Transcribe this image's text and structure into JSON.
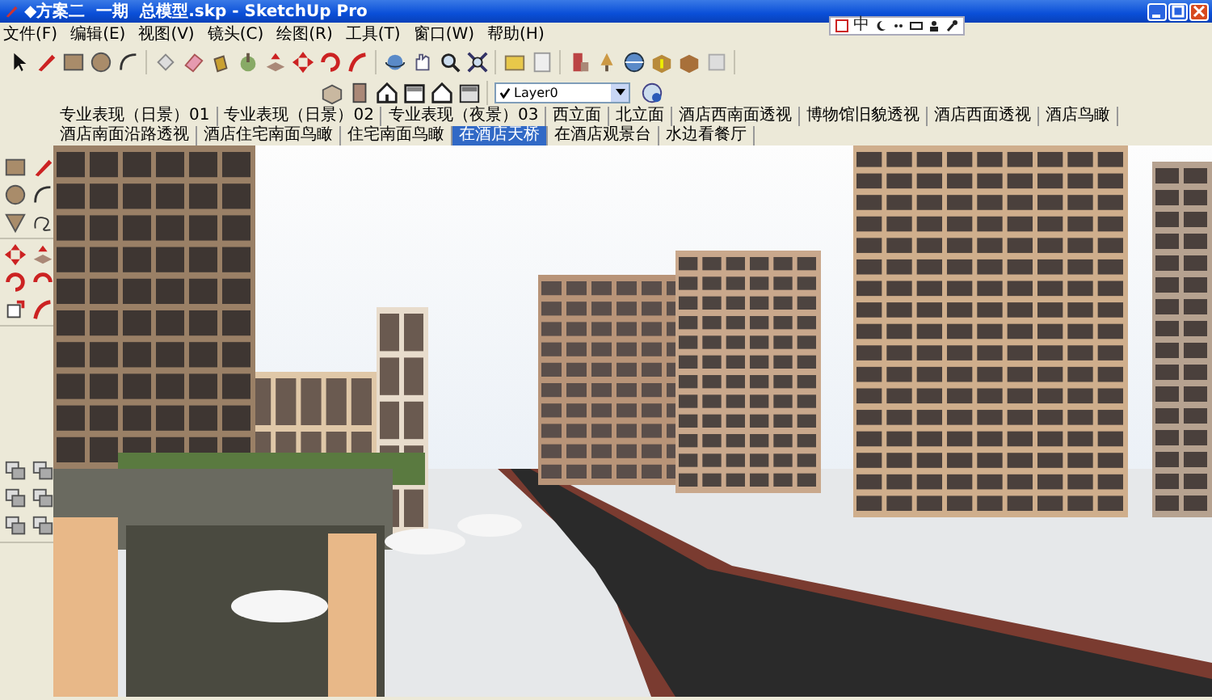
{
  "window": {
    "title": "◆方案二  一期  总模型.skp - SketchUp Pro"
  },
  "ime_bar": {
    "mode": "中"
  },
  "menu": [
    "文件(F)",
    "编辑(E)",
    "视图(V)",
    "镜头(C)",
    "绘图(R)",
    "工具(T)",
    "窗口(W)",
    "帮助(H)"
  ],
  "layer_dropdown": {
    "value": "Layer0"
  },
  "scene_tabs": [
    {
      "label": "专业表现（日景）01",
      "selected": false
    },
    {
      "label": "专业表现（日景）02",
      "selected": false
    },
    {
      "label": "专业表现（夜景）03",
      "selected": false
    },
    {
      "label": "西立面",
      "selected": false
    },
    {
      "label": "北立面",
      "selected": false
    },
    {
      "label": "酒店西南面透视",
      "selected": false
    },
    {
      "label": "博物馆旧貌透视",
      "selected": false
    },
    {
      "label": "酒店西面透视",
      "selected": false
    },
    {
      "label": "酒店鸟瞰",
      "selected": false
    },
    {
      "label": "酒店南面沿路透视",
      "selected": false
    },
    {
      "label": "酒店住宅南面鸟瞰",
      "selected": false
    },
    {
      "label": "住宅南面鸟瞰",
      "selected": false
    },
    {
      "label": "在酒店天桥",
      "selected": true
    },
    {
      "label": "在酒店观景台",
      "selected": false
    },
    {
      "label": "水边看餐厅",
      "selected": false
    }
  ]
}
